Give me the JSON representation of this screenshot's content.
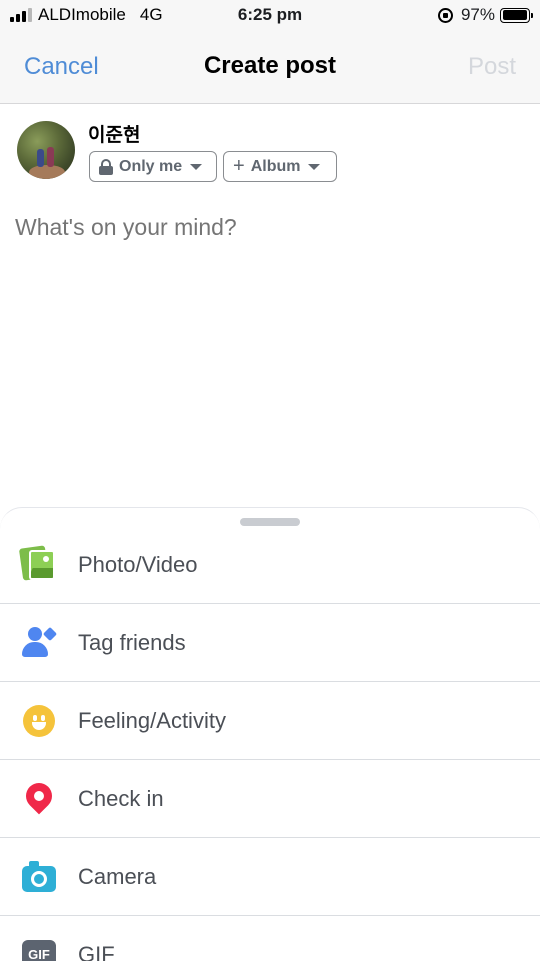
{
  "status_bar": {
    "carrier": "ALDImobile",
    "network": "4G",
    "time": "6:25 pm",
    "battery": "97%",
    "battery_level": 0.97,
    "signal_bars": 3
  },
  "nav": {
    "cancel_label": "Cancel",
    "title": "Create post",
    "post_label": "Post"
  },
  "user": {
    "name": "이준현",
    "privacy_label": "Only me",
    "album_label": "Album"
  },
  "composer": {
    "placeholder": "What's on your mind?"
  },
  "options": [
    {
      "label": "Photo/Video",
      "icon": "photo-video-icon",
      "color": "#7dbd4a"
    },
    {
      "label": "Tag friends",
      "icon": "tag-friends-icon",
      "color": "#4f86f0"
    },
    {
      "label": "Feeling/Activity",
      "icon": "smiley-icon",
      "color": "#f5c33b"
    },
    {
      "label": "Check in",
      "icon": "location-pin-icon",
      "color": "#f02849"
    },
    {
      "label": "Camera",
      "icon": "camera-icon",
      "color": "#2eafd6"
    },
    {
      "label": "GIF",
      "icon": "gif-icon",
      "color": "#5c6470"
    }
  ],
  "colors": {
    "accent": "#4f8cd6",
    "post_disabled": "#d4d7dc"
  }
}
